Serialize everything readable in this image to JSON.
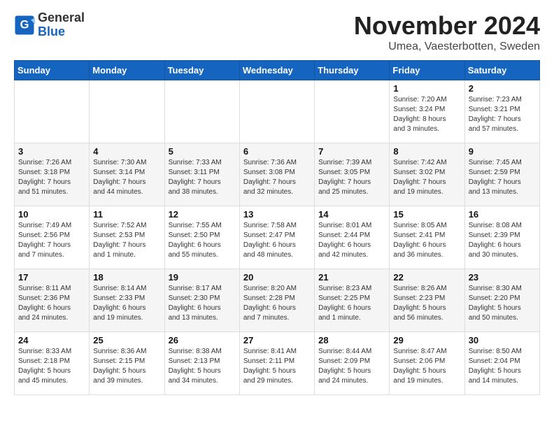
{
  "logo": {
    "general": "General",
    "blue": "Blue"
  },
  "title": "November 2024",
  "subtitle": "Umea, Vaesterbotten, Sweden",
  "weekdays": [
    "Sunday",
    "Monday",
    "Tuesday",
    "Wednesday",
    "Thursday",
    "Friday",
    "Saturday"
  ],
  "weeks": [
    [
      {
        "day": "",
        "info": ""
      },
      {
        "day": "",
        "info": ""
      },
      {
        "day": "",
        "info": ""
      },
      {
        "day": "",
        "info": ""
      },
      {
        "day": "",
        "info": ""
      },
      {
        "day": "1",
        "info": "Sunrise: 7:20 AM\nSunset: 3:24 PM\nDaylight: 8 hours\nand 3 minutes."
      },
      {
        "day": "2",
        "info": "Sunrise: 7:23 AM\nSunset: 3:21 PM\nDaylight: 7 hours\nand 57 minutes."
      }
    ],
    [
      {
        "day": "3",
        "info": "Sunrise: 7:26 AM\nSunset: 3:18 PM\nDaylight: 7 hours\nand 51 minutes."
      },
      {
        "day": "4",
        "info": "Sunrise: 7:30 AM\nSunset: 3:14 PM\nDaylight: 7 hours\nand 44 minutes."
      },
      {
        "day": "5",
        "info": "Sunrise: 7:33 AM\nSunset: 3:11 PM\nDaylight: 7 hours\nand 38 minutes."
      },
      {
        "day": "6",
        "info": "Sunrise: 7:36 AM\nSunset: 3:08 PM\nDaylight: 7 hours\nand 32 minutes."
      },
      {
        "day": "7",
        "info": "Sunrise: 7:39 AM\nSunset: 3:05 PM\nDaylight: 7 hours\nand 25 minutes."
      },
      {
        "day": "8",
        "info": "Sunrise: 7:42 AM\nSunset: 3:02 PM\nDaylight: 7 hours\nand 19 minutes."
      },
      {
        "day": "9",
        "info": "Sunrise: 7:45 AM\nSunset: 2:59 PM\nDaylight: 7 hours\nand 13 minutes."
      }
    ],
    [
      {
        "day": "10",
        "info": "Sunrise: 7:49 AM\nSunset: 2:56 PM\nDaylight: 7 hours\nand 7 minutes."
      },
      {
        "day": "11",
        "info": "Sunrise: 7:52 AM\nSunset: 2:53 PM\nDaylight: 7 hours\nand 1 minute."
      },
      {
        "day": "12",
        "info": "Sunrise: 7:55 AM\nSunset: 2:50 PM\nDaylight: 6 hours\nand 55 minutes."
      },
      {
        "day": "13",
        "info": "Sunrise: 7:58 AM\nSunset: 2:47 PM\nDaylight: 6 hours\nand 48 minutes."
      },
      {
        "day": "14",
        "info": "Sunrise: 8:01 AM\nSunset: 2:44 PM\nDaylight: 6 hours\nand 42 minutes."
      },
      {
        "day": "15",
        "info": "Sunrise: 8:05 AM\nSunset: 2:41 PM\nDaylight: 6 hours\nand 36 minutes."
      },
      {
        "day": "16",
        "info": "Sunrise: 8:08 AM\nSunset: 2:39 PM\nDaylight: 6 hours\nand 30 minutes."
      }
    ],
    [
      {
        "day": "17",
        "info": "Sunrise: 8:11 AM\nSunset: 2:36 PM\nDaylight: 6 hours\nand 24 minutes."
      },
      {
        "day": "18",
        "info": "Sunrise: 8:14 AM\nSunset: 2:33 PM\nDaylight: 6 hours\nand 19 minutes."
      },
      {
        "day": "19",
        "info": "Sunrise: 8:17 AM\nSunset: 2:30 PM\nDaylight: 6 hours\nand 13 minutes."
      },
      {
        "day": "20",
        "info": "Sunrise: 8:20 AM\nSunset: 2:28 PM\nDaylight: 6 hours\nand 7 minutes."
      },
      {
        "day": "21",
        "info": "Sunrise: 8:23 AM\nSunset: 2:25 PM\nDaylight: 6 hours\nand 1 minute."
      },
      {
        "day": "22",
        "info": "Sunrise: 8:26 AM\nSunset: 2:23 PM\nDaylight: 5 hours\nand 56 minutes."
      },
      {
        "day": "23",
        "info": "Sunrise: 8:30 AM\nSunset: 2:20 PM\nDaylight: 5 hours\nand 50 minutes."
      }
    ],
    [
      {
        "day": "24",
        "info": "Sunrise: 8:33 AM\nSunset: 2:18 PM\nDaylight: 5 hours\nand 45 minutes."
      },
      {
        "day": "25",
        "info": "Sunrise: 8:36 AM\nSunset: 2:15 PM\nDaylight: 5 hours\nand 39 minutes."
      },
      {
        "day": "26",
        "info": "Sunrise: 8:38 AM\nSunset: 2:13 PM\nDaylight: 5 hours\nand 34 minutes."
      },
      {
        "day": "27",
        "info": "Sunrise: 8:41 AM\nSunset: 2:11 PM\nDaylight: 5 hours\nand 29 minutes."
      },
      {
        "day": "28",
        "info": "Sunrise: 8:44 AM\nSunset: 2:09 PM\nDaylight: 5 hours\nand 24 minutes."
      },
      {
        "day": "29",
        "info": "Sunrise: 8:47 AM\nSunset: 2:06 PM\nDaylight: 5 hours\nand 19 minutes."
      },
      {
        "day": "30",
        "info": "Sunrise: 8:50 AM\nSunset: 2:04 PM\nDaylight: 5 hours\nand 14 minutes."
      }
    ]
  ]
}
